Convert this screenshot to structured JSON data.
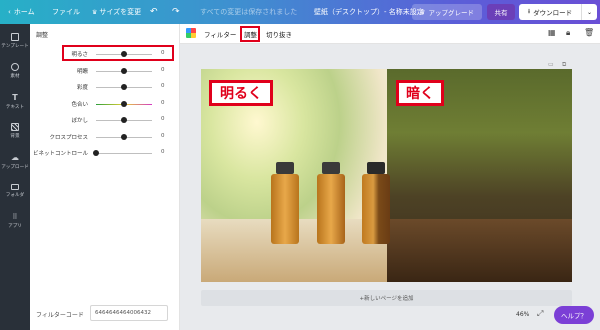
{
  "topbar": {
    "home": "ホーム",
    "file": "ファイル",
    "resize": "サイズを変更",
    "saved_status": "すべての変更は保存されました",
    "doc_title": "壁紙（デスクトップ）- 名称未設定",
    "upgrade": "アップグレード",
    "share": "共有",
    "download": "ダウンロード"
  },
  "rail": {
    "items": [
      "テンプレート",
      "素材",
      "テキスト",
      "背景",
      "アップロード",
      "フォルダ",
      "アプリ"
    ]
  },
  "panel": {
    "title": "調整",
    "adjustments": [
      {
        "label": "明るさ",
        "value": "0",
        "level": 0.5
      },
      {
        "label": "明瞭",
        "value": "0",
        "level": 0.5
      },
      {
        "label": "彩度",
        "value": "0",
        "level": 0.5
      },
      {
        "label": "色合い",
        "value": "0",
        "level": 0.5
      },
      {
        "label": "ぼかし",
        "value": "0",
        "level": 0.5
      },
      {
        "label": "クロスプロセス",
        "value": "0",
        "level": 0.5
      },
      {
        "label": "ビネットコントロール",
        "value": "0",
        "level": 0.0
      }
    ],
    "filter_code_label": "フィルターコード",
    "filter_code_value": "6464646464006432"
  },
  "subbar": {
    "filter": "フィルター",
    "adjust": "調整",
    "crop": "切り抜き"
  },
  "canvas": {
    "label_bright": "明るく",
    "label_dark": "暗く",
    "add_page": "+新しいページを追加",
    "zoom": "46%",
    "help": "ヘルプ？"
  },
  "icons": {
    "back": "chevron-left-icon",
    "crown": "crown-icon",
    "undo": "undo-icon",
    "redo": "redo-icon",
    "download": "download-icon",
    "checker": "transparency-icon",
    "lock": "lock-icon",
    "trash": "trash-icon"
  },
  "colors": {
    "accent_red": "#e0001b",
    "help_purple": "#7b3fd6",
    "share_purple": "#6b3fb8"
  }
}
